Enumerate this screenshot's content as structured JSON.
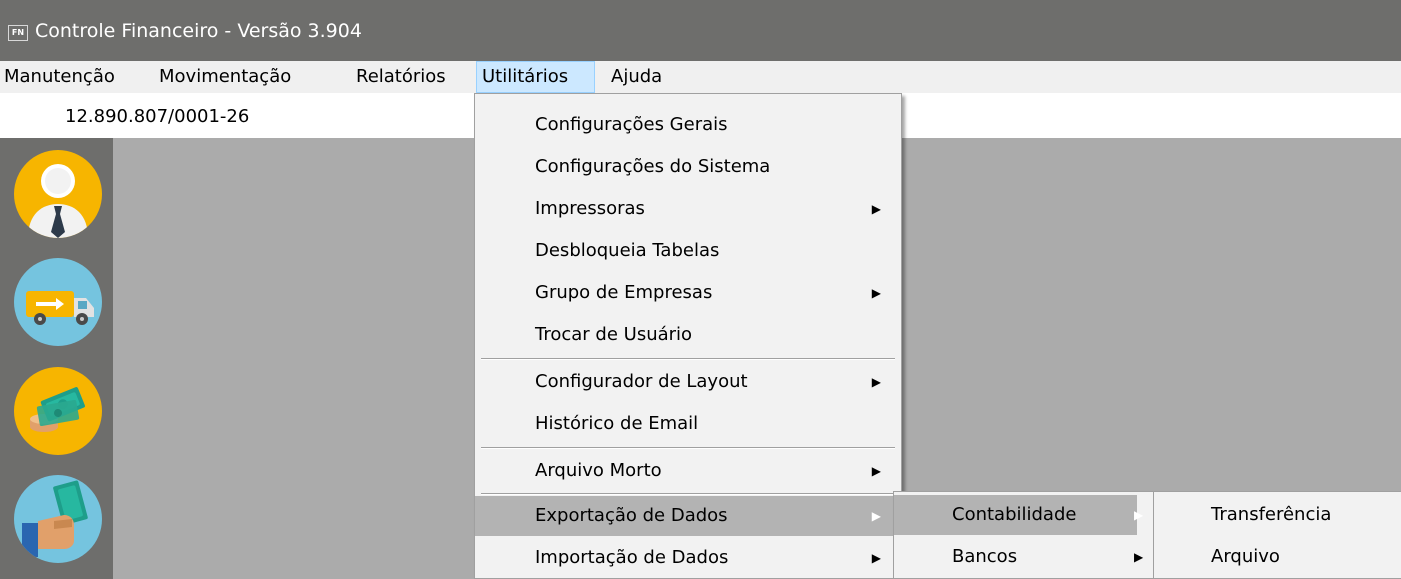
{
  "window": {
    "app_badge": "FN",
    "title": "Controle Financeiro - Versão 3.904"
  },
  "menubar": {
    "items": [
      {
        "label": "Manutenção"
      },
      {
        "label": "Movimentação"
      },
      {
        "label": "Relatórios"
      },
      {
        "label": "Utilitários",
        "active": true
      },
      {
        "label": "Ajuda"
      }
    ]
  },
  "company": {
    "cnpj": "12.890.807/0001-26"
  },
  "sidebar": {
    "shortcuts": [
      {
        "icon": "person-icon",
        "color": "#f7b500"
      },
      {
        "icon": "delivery-truck-icon",
        "color": "#75c4df"
      },
      {
        "icon": "money-stack-icon",
        "color": "#f7b500"
      },
      {
        "icon": "hand-money-icon",
        "color": "#75c4df"
      }
    ]
  },
  "utilitarios_menu": {
    "items": [
      {
        "label": "Configurações Gerais",
        "submenu": false
      },
      {
        "label": "Configurações do Sistema",
        "submenu": false
      },
      {
        "label": "Impressoras",
        "submenu": true
      },
      {
        "label": "Desbloqueia Tabelas",
        "submenu": false
      },
      {
        "label": "Grupo de Empresas",
        "submenu": true
      },
      {
        "label": "Trocar de Usuário",
        "submenu": false
      },
      {
        "label": "Configurador de Layout",
        "submenu": true
      },
      {
        "label": "Histórico de Email",
        "submenu": false
      },
      {
        "label": "Arquivo Morto",
        "submenu": true
      },
      {
        "label": "Exportação de Dados",
        "submenu": true,
        "highlighted": true
      },
      {
        "label": "Importação de Dados",
        "submenu": true
      }
    ]
  },
  "exportacao_submenu": {
    "items": [
      {
        "label": "Contabilidade",
        "submenu": true,
        "highlighted": true
      },
      {
        "label": "Bancos",
        "submenu": true
      }
    ]
  },
  "contabilidade_submenu": {
    "items": [
      {
        "label": "Transferência"
      },
      {
        "label": "Arquivo"
      }
    ]
  },
  "colors": {
    "titlebar": "#6e6e6c",
    "menu_active": "#cce8ff",
    "menu_highlight": "#b3b3b3",
    "workspace": "#ababab"
  }
}
